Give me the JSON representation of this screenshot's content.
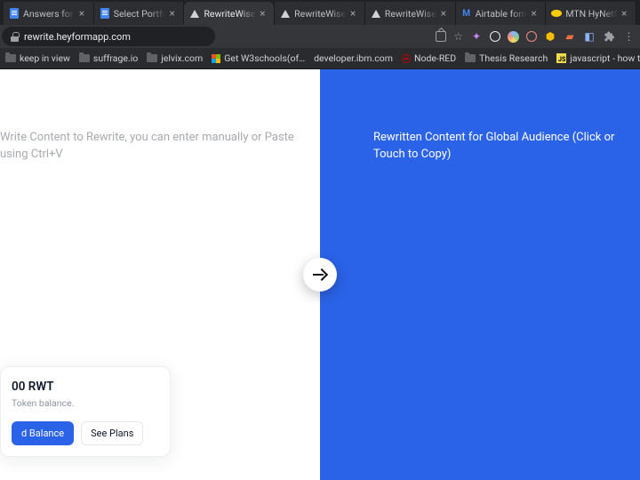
{
  "browser": {
    "tabs": [
      {
        "title": "Answers for L",
        "fav": "doc"
      },
      {
        "title": "Select Portfoli",
        "fav": "doc"
      },
      {
        "title": "RewriteWise -",
        "fav": "tri"
      },
      {
        "title": "RewriteWise -",
        "fav": "tri"
      },
      {
        "title": "RewriteWise -",
        "fav": "tri"
      },
      {
        "title": "Airtable form",
        "fav": "gmail"
      },
      {
        "title": "MTN HyNetfl",
        "fav": "mtn"
      }
    ],
    "active_tab_index": 2,
    "url": "rewrite.heyformapp.com",
    "bookmarks": [
      {
        "label": "keep in view",
        "icon": "folder"
      },
      {
        "label": "suffrage.io",
        "icon": "folder"
      },
      {
        "label": "jelvix.com",
        "icon": "folder"
      },
      {
        "label": "Get W3schools(of…",
        "icon": "four"
      },
      {
        "label": "developer.ibm.com",
        "icon": "none"
      },
      {
        "label": "Node-RED",
        "icon": "nodered"
      },
      {
        "label": "Thesis Research",
        "icon": "folder"
      },
      {
        "label": "javascript - how t…",
        "icon": "js"
      }
    ]
  },
  "app": {
    "left_placeholder": "Write Content to Rewrite, you can enter manually or Paste using Ctrl+V",
    "right_placeholder": "Rewritten Content for Global Audience (Click or Touch to Copy)",
    "balance": {
      "amount": "00 RWT",
      "subtitle": "Token balance.",
      "primary_btn": "d Balance",
      "secondary_btn": "See Plans"
    }
  }
}
